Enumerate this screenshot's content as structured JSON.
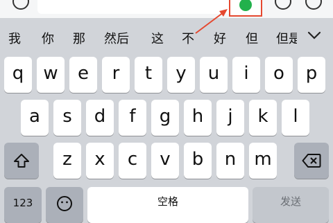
{
  "candidates": [
    "我",
    "你",
    "那",
    "然后",
    "这",
    "不",
    "好",
    "但",
    "但是"
  ],
  "rows": {
    "row1": [
      "q",
      "w",
      "e",
      "r",
      "t",
      "y",
      "u",
      "i",
      "o",
      "p"
    ],
    "row2": [
      "a",
      "s",
      "d",
      "f",
      "g",
      "h",
      "j",
      "k",
      "l"
    ],
    "row3": [
      "z",
      "x",
      "c",
      "v",
      "b",
      "n",
      "m"
    ]
  },
  "bottom": {
    "numbers_label": "123",
    "space_label": "空格",
    "send_label": "发送"
  },
  "icons": {
    "shift": "shift-icon",
    "delete": "backspace-icon",
    "emoji": "emoji-icon",
    "expand": "chevron-down-icon",
    "voice": "voice-icon"
  },
  "colors": {
    "annotation": "#e5482f",
    "voice": "#22b14c"
  }
}
